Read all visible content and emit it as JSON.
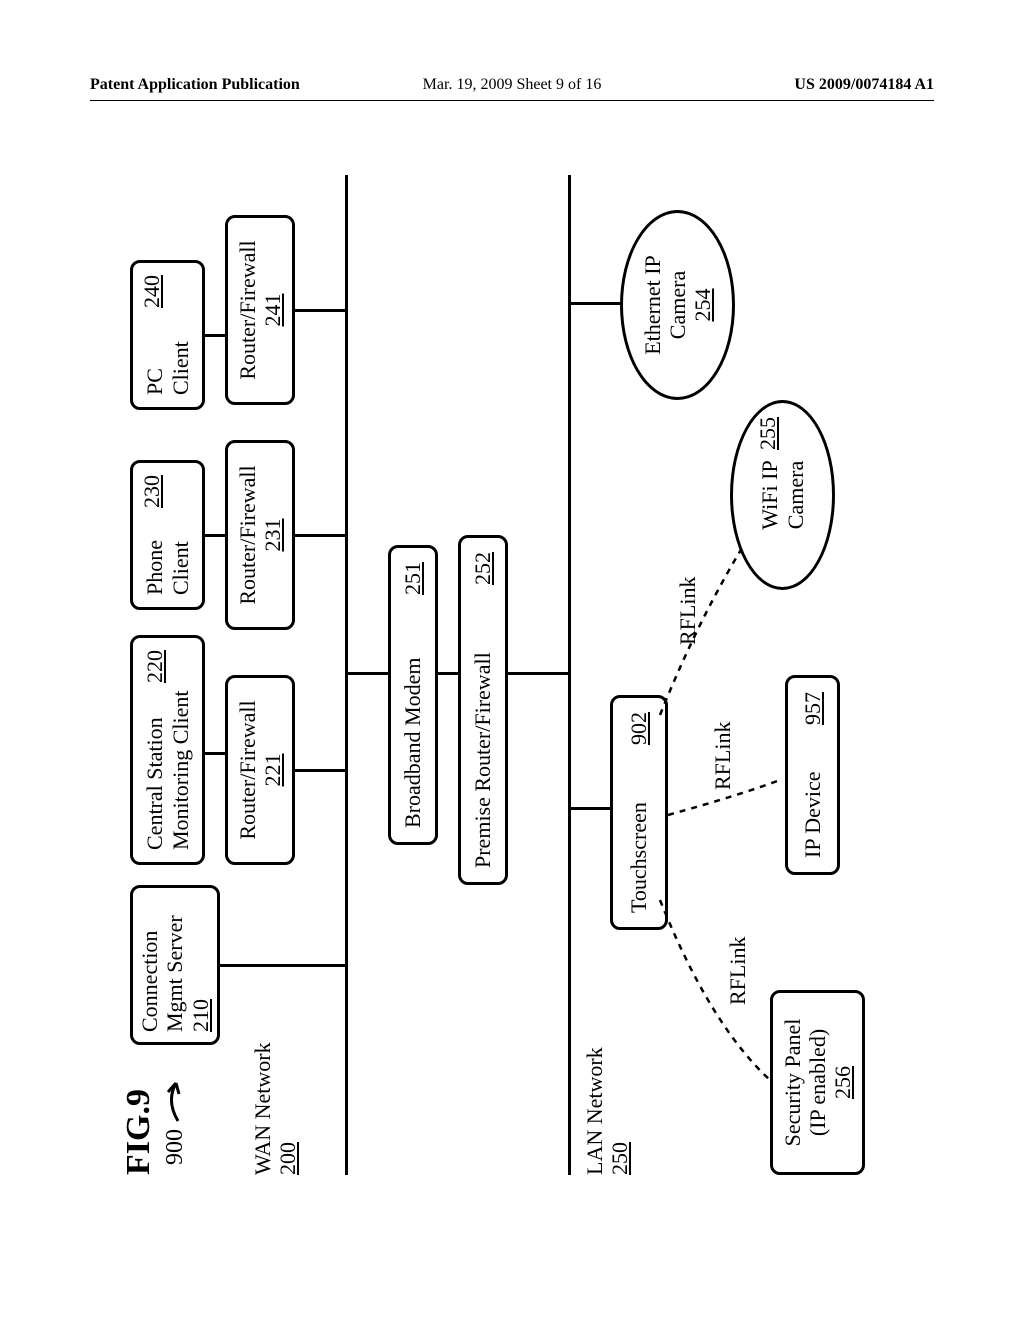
{
  "header": {
    "left": "Patent Application Publication",
    "center": "Mar. 19, 2009  Sheet 9 of 16",
    "right": "US 2009/0074184 A1"
  },
  "fig_label": "FIG.9",
  "fig_ref": "900",
  "wan_label": "WAN Network",
  "wan_ref": "200",
  "lan_label": "LAN Network",
  "lan_ref": "250",
  "boxes": {
    "cms": {
      "l1": "Connection",
      "l2": "Mgmt Server",
      "ref": "210"
    },
    "csm": {
      "l1": "Central Station",
      "l2": "Monitoring Client",
      "ref": "220"
    },
    "phone": {
      "l1": "Phone",
      "l2": "Client",
      "ref": "230"
    },
    "pc": {
      "l1": "PC",
      "l2": "Client",
      "ref": "240"
    },
    "rf221": {
      "l1": "Router/Firewall",
      "ref": "221"
    },
    "rf231": {
      "l1": "Router/Firewall",
      "ref": "231"
    },
    "rf241": {
      "l1": "Router/Firewall",
      "ref": "241"
    },
    "modem": {
      "l1": "Broadband Modem",
      "ref": "251"
    },
    "prf": {
      "l1": "Premise Router/Firewall",
      "ref": "252"
    },
    "ts": {
      "l1": "Touchscreen",
      "ref": "902"
    },
    "sp": {
      "l1": "Security Panel",
      "l2": "(IP enabled)",
      "ref": "256"
    },
    "ipd": {
      "l1": "IP Device",
      "ref": "957"
    },
    "ethcam": {
      "l1": "Ethernet IP",
      "l2": "Camera",
      "ref": "254"
    },
    "wificam": {
      "l1": "WiFi IP",
      "l2": "Camera",
      "ref": "255"
    }
  },
  "rflink": "RFLink"
}
